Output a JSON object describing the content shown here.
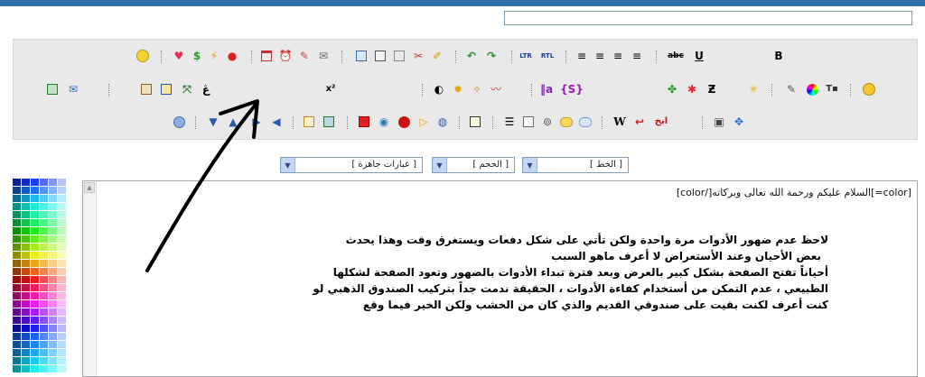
{
  "toolbar": {
    "bold_label": "B",
    "underline_label": "U",
    "strike_label": "abc",
    "superscript_label": "x²",
    "ltr_label": "LTR",
    "rtl_label": "RTL",
    "word_label": "W",
    "tag_label": "{S}"
  },
  "selects": {
    "font_label": "[ الخط ]",
    "size_label": "[ الحجم ]",
    "phrases_label": "[ عبارات جاهزة ]"
  },
  "editor": {
    "code_line": "[color=]السلام عليكم ورحمة الله تعالى وبركاته[/color]",
    "message_lines": [
      "لاحظ عدم ضهور الأدوات مرة واحدة ولكن تأتي على شكل دفعات ويستغرق وقت وهذا يحدث",
      "بعض الأحيان وعند الأستعراض لا أعرف ماهو السبب",
      "أحياناً تفتح الصفحة بشكل كبير بالعرض وبعد فترة تبداء الأدوات بالضهور وتعود الصفحة لشكلها",
      "الطبيعي ، عدم التمكن من أستخدام كفاءة الأدوات ، الحقيقة ندمت جداً بتركيب الصندوق الذهبي لو",
      "كنت أعرف لكنت بقيت على صندوقي القديم والذي كان من الخشب ولكن الخير فيما وقع"
    ]
  },
  "colors": {
    "topbar": "#2f6ea7",
    "panel": "#e9e9e9",
    "select_arrow": "#c6d6f2"
  },
  "icons": {
    "row1": [
      "smiley-icon",
      "heart-icon",
      "dollar-icon",
      "flash-icon",
      "award-icon",
      "calendar-icon",
      "alarm-clock-icon",
      "pencil-icon",
      "comment-icon",
      "copy-icon",
      "paste-icon",
      "duplicate-icon",
      "cut-icon",
      "eraser-icon",
      "undo-icon",
      "redo-icon",
      "ltr-icon",
      "rtl-icon",
      "align-left-icon",
      "align-center-icon",
      "align-right-icon",
      "justify-icon",
      "strike-icon",
      "underline-icon",
      "bold-icon"
    ],
    "row2": [
      "image-icon",
      "email-icon",
      "gallery-icon",
      "table-icon",
      "resize-icon",
      "curl-icon",
      "superscript-icon",
      "contrast-icon",
      "sun-icon",
      "magic-icon",
      "line-icon",
      "bars-icon",
      "tag-icon",
      "clover-icon",
      "flower-icon",
      "return-icon",
      "sparkle-icon",
      "highlighter-icon",
      "color-wheel-icon",
      "clear-format-icon",
      "emoji-icon"
    ],
    "row3": [
      "up-circle-icon",
      "arrow-down-icon",
      "arrow-up-icon",
      "arrow-right-icon",
      "arrow-left-icon",
      "frame-icon",
      "picture-icon",
      "youtube-icon",
      "globe-icon",
      "flash-player-icon",
      "media-icon",
      "speech-icon",
      "list-icon",
      "list-lines-icon",
      "php-icon",
      "code-icon",
      "chat-icon",
      "chat2-icon",
      "word-icon",
      "red-arrow-icon",
      "arabic-logo-icon",
      "preview-icon",
      "move-icon"
    ]
  }
}
